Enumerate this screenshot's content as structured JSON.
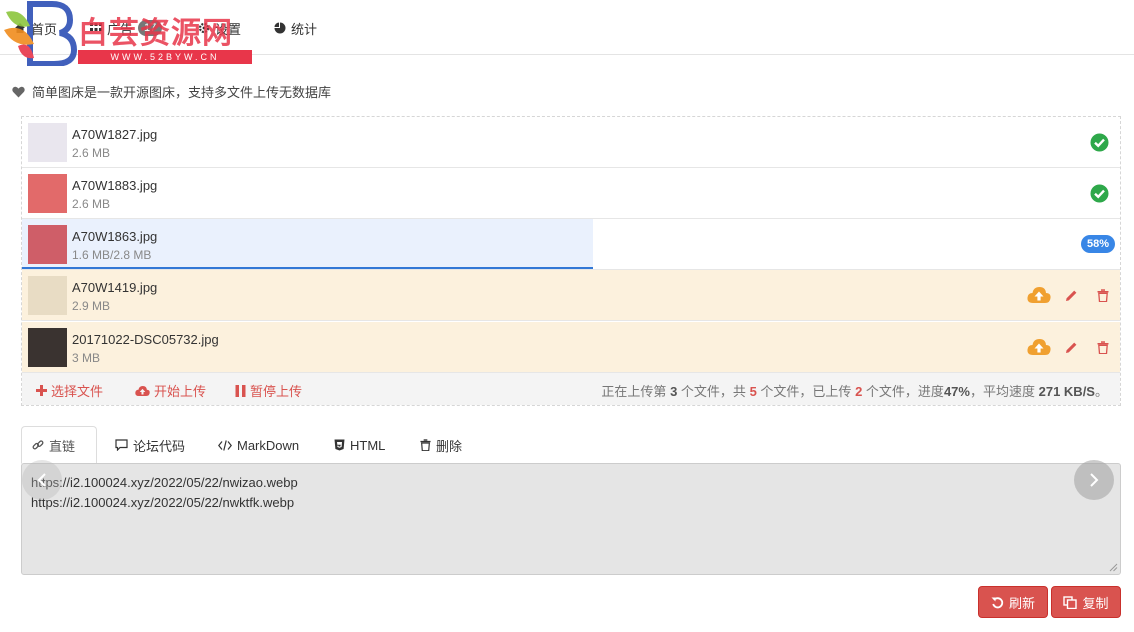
{
  "nav": {
    "home": "首页",
    "ads": "广告",
    "ads_badge": "17",
    "settings": "设置",
    "stats": "统计"
  },
  "watermark": {
    "title": "白芸资源网",
    "subtitle": "WWW.52BYW.CN"
  },
  "intro": "简单图床是一款开源图床，支持多文件上传无数据库",
  "files": [
    {
      "name": "A70W1827.jpg",
      "size": "2.6 MB",
      "status": "done",
      "thumb_color": "#e9e6ee"
    },
    {
      "name": "A70W1883.jpg",
      "size": "2.6 MB",
      "status": "done",
      "thumb_color": "#e26a6a"
    },
    {
      "name": "A70W1863.jpg",
      "size": "1.6 MB/2.8 MB",
      "status": "uploading",
      "percent_label": "58%",
      "progress": 0.52,
      "thumb_color": "#cf5e68"
    },
    {
      "name": "A70W1419.jpg",
      "size": "2.9 MB",
      "status": "pending",
      "thumb_color": "#e8dcc4"
    },
    {
      "name": "20171022-DSC05732.jpg",
      "size": "3 MB",
      "status": "pending",
      "thumb_color": "#3a3330"
    }
  ],
  "toolbar": {
    "choose": "选择文件",
    "start": "开始上传",
    "pause": "暂停上传",
    "stats_prefix": "正在上传第",
    "current": "3",
    "stats_mid1": "个文件，共",
    "total": "5",
    "stats_mid2": "个文件，已上传",
    "uploaded": "2",
    "stats_mid3": "个文件，进度",
    "progress": "47%",
    "stats_mid4": "，平均速度",
    "speed": "271 KB/S",
    "stats_end": "。"
  },
  "tabs": [
    {
      "label": "直链",
      "icon": "link-icon"
    },
    {
      "label": "论坛代码",
      "icon": "comment-icon"
    },
    {
      "label": "MarkDown",
      "icon": "code-icon"
    },
    {
      "label": "HTML",
      "icon": "html5-icon"
    },
    {
      "label": "删除",
      "icon": "trash-icon"
    }
  ],
  "output": {
    "line1": "https://i2.100024.xyz/2022/05/22/nwizao.webp",
    "line2": "https://i2.100024.xyz/2022/05/22/nwktfk.webp"
  },
  "buttons": {
    "refresh": "刷新",
    "copy": "复制"
  },
  "colors": {
    "accent_red": "#d9534f",
    "success_green": "#2ea84a",
    "progress_blue": "#3886e6",
    "pending_bg": "#fcf1dd",
    "cloud_orange": "#f0a030"
  }
}
